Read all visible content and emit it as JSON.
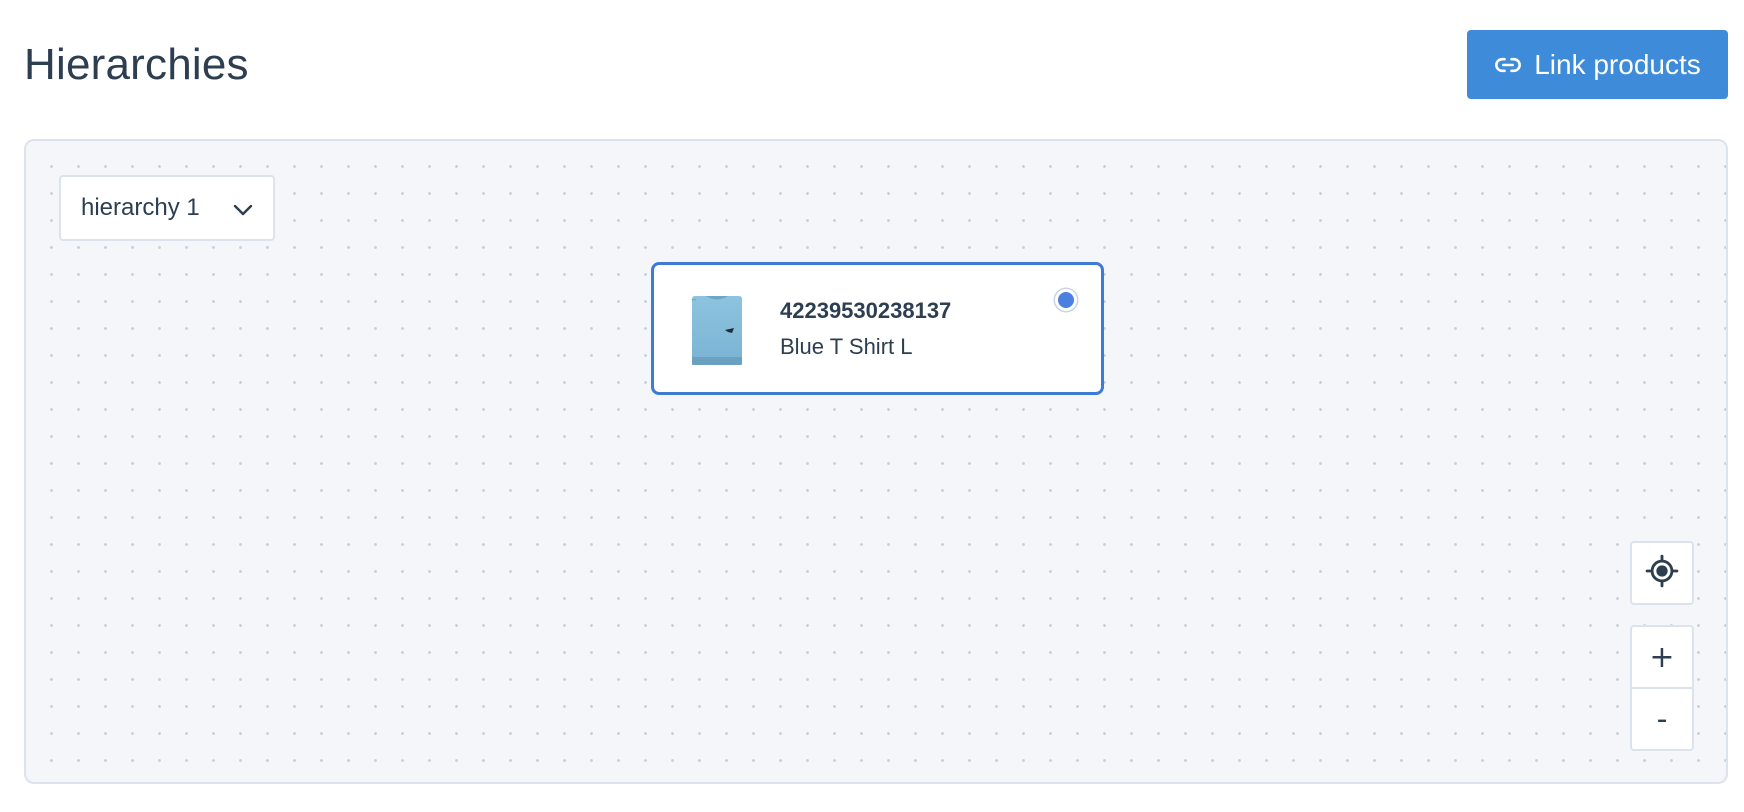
{
  "header": {
    "title": "Hierarchies",
    "link_button_label": "Link products",
    "link_button_icon": "link-icon",
    "accent_color": "#3d8bd9"
  },
  "canvas": {
    "hierarchy_select": {
      "selected": "hierarchy 1",
      "icon": "chevron-down-icon"
    },
    "nodes": [
      {
        "product_id": "42239530238137",
        "name": "Blue T Shirt L",
        "thumbnail": "t-shirt-image",
        "selected": true,
        "border_color": "#3d7bd6"
      }
    ],
    "controls": {
      "center_icon": "crosshair-target-icon",
      "zoom_in_label": "+",
      "zoom_out_label": "-"
    }
  }
}
